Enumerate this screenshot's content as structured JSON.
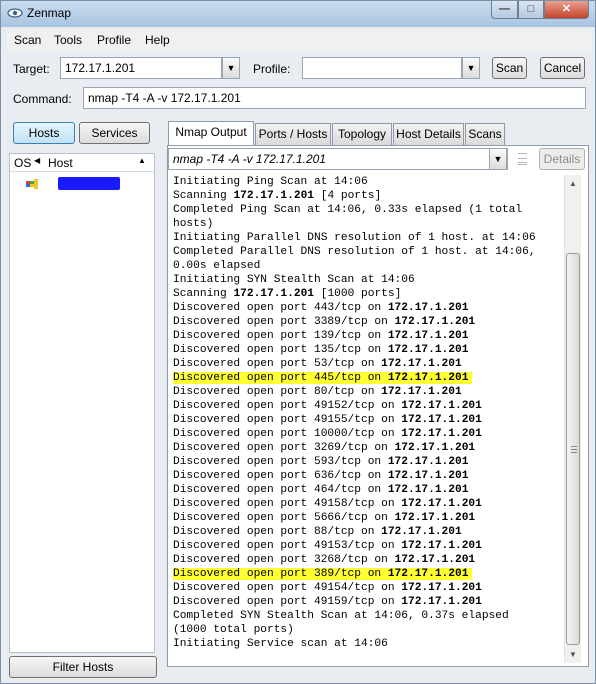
{
  "window": {
    "title": "Zenmap"
  },
  "menu": [
    "Scan",
    "Tools",
    "Profile",
    "Help"
  ],
  "toolbar": {
    "target_label": "Target:",
    "target_value": "172.17.1.201",
    "profile_label": "Profile:",
    "profile_value": "",
    "scan_button": "Scan",
    "cancel_button": "Cancel",
    "command_label": "Command:",
    "command_value": "nmap -T4 -A -v 172.17.1.201"
  },
  "left_panel": {
    "hosts_button": "Hosts",
    "services_button": "Services",
    "col_os": "OS",
    "col_host": "Host",
    "filter_button": "Filter Hosts"
  },
  "tabs": [
    "Nmap Output",
    "Ports / Hosts",
    "Topology",
    "Host Details",
    "Scans"
  ],
  "output_panel": {
    "selected_command": "nmap -T4 -A -v 172.17.1.201",
    "details_button": "Details",
    "lines": [
      {
        "text": "Initiating Ping Scan at 14:06"
      },
      {
        "pre": "Scanning ",
        "bold": "172.17.1.201",
        "post": " [4 ports]"
      },
      {
        "text": "Completed Ping Scan at 14:06, 0.33s elapsed (1 total"
      },
      {
        "text": "hosts)"
      },
      {
        "text": "Initiating Parallel DNS resolution of 1 host. at 14:06"
      },
      {
        "text": "Completed Parallel DNS resolution of 1 host. at 14:06,"
      },
      {
        "text": "0.00s elapsed"
      },
      {
        "text": "Initiating SYN Stealth Scan at 14:06"
      },
      {
        "pre": "Scanning ",
        "bold": "172.17.1.201",
        "post": " [1000 ports]"
      },
      {
        "pre": "Discovered open port 443/tcp on ",
        "bold": "172.17.1.201"
      },
      {
        "pre": "Discovered open port 3389/tcp on ",
        "bold": "172.17.1.201"
      },
      {
        "pre": "Discovered open port 139/tcp on ",
        "bold": "172.17.1.201"
      },
      {
        "pre": "Discovered open port 135/tcp on ",
        "bold": "172.17.1.201"
      },
      {
        "pre": "Discovered open port 53/tcp on ",
        "bold": "172.17.1.201"
      },
      {
        "pre": "Discovered open port 445/tcp on ",
        "bold": "172.17.1.201",
        "highlight": true
      },
      {
        "pre": "Discovered open port 80/tcp on ",
        "bold": "172.17.1.201"
      },
      {
        "pre": "Discovered open port 49152/tcp on ",
        "bold": "172.17.1.201"
      },
      {
        "pre": "Discovered open port 49155/tcp on ",
        "bold": "172.17.1.201"
      },
      {
        "pre": "Discovered open port 10000/tcp on ",
        "bold": "172.17.1.201"
      },
      {
        "pre": "Discovered open port 3269/tcp on ",
        "bold": "172.17.1.201"
      },
      {
        "pre": "Discovered open port 593/tcp on ",
        "bold": "172.17.1.201"
      },
      {
        "pre": "Discovered open port 636/tcp on ",
        "bold": "172.17.1.201"
      },
      {
        "pre": "Discovered open port 464/tcp on ",
        "bold": "172.17.1.201"
      },
      {
        "pre": "Discovered open port 49158/tcp on ",
        "bold": "172.17.1.201"
      },
      {
        "pre": "Discovered open port 5666/tcp on ",
        "bold": "172.17.1.201"
      },
      {
        "pre": "Discovered open port 88/tcp on ",
        "bold": "172.17.1.201"
      },
      {
        "pre": "Discovered open port 49153/tcp on ",
        "bold": "172.17.1.201"
      },
      {
        "pre": "Discovered open port 3268/tcp on ",
        "bold": "172.17.1.201"
      },
      {
        "pre": "Discovered open port 389/tcp on ",
        "bold": "172.17.1.201",
        "highlight": true
      },
      {
        "pre": "Discovered open port 49154/tcp on ",
        "bold": "172.17.1.201"
      },
      {
        "pre": "Discovered open port 49159/tcp on ",
        "bold": "172.17.1.201"
      },
      {
        "text": "Completed SYN Stealth Scan at 14:06, 0.37s elapsed"
      },
      {
        "text": "(1000 total ports)"
      },
      {
        "text": "Initiating Service scan at 14:06"
      }
    ]
  },
  "colors": {
    "highlight": "#ffff33",
    "redaction": "#1a1aff",
    "title_bar": "#b9d1ea"
  },
  "icons": [
    "zenmap-eye-icon",
    "minimize-icon",
    "maximize-icon",
    "close-icon",
    "host-os-icon",
    "dropdown-arrow-icon",
    "sort-arrow-icon"
  ]
}
